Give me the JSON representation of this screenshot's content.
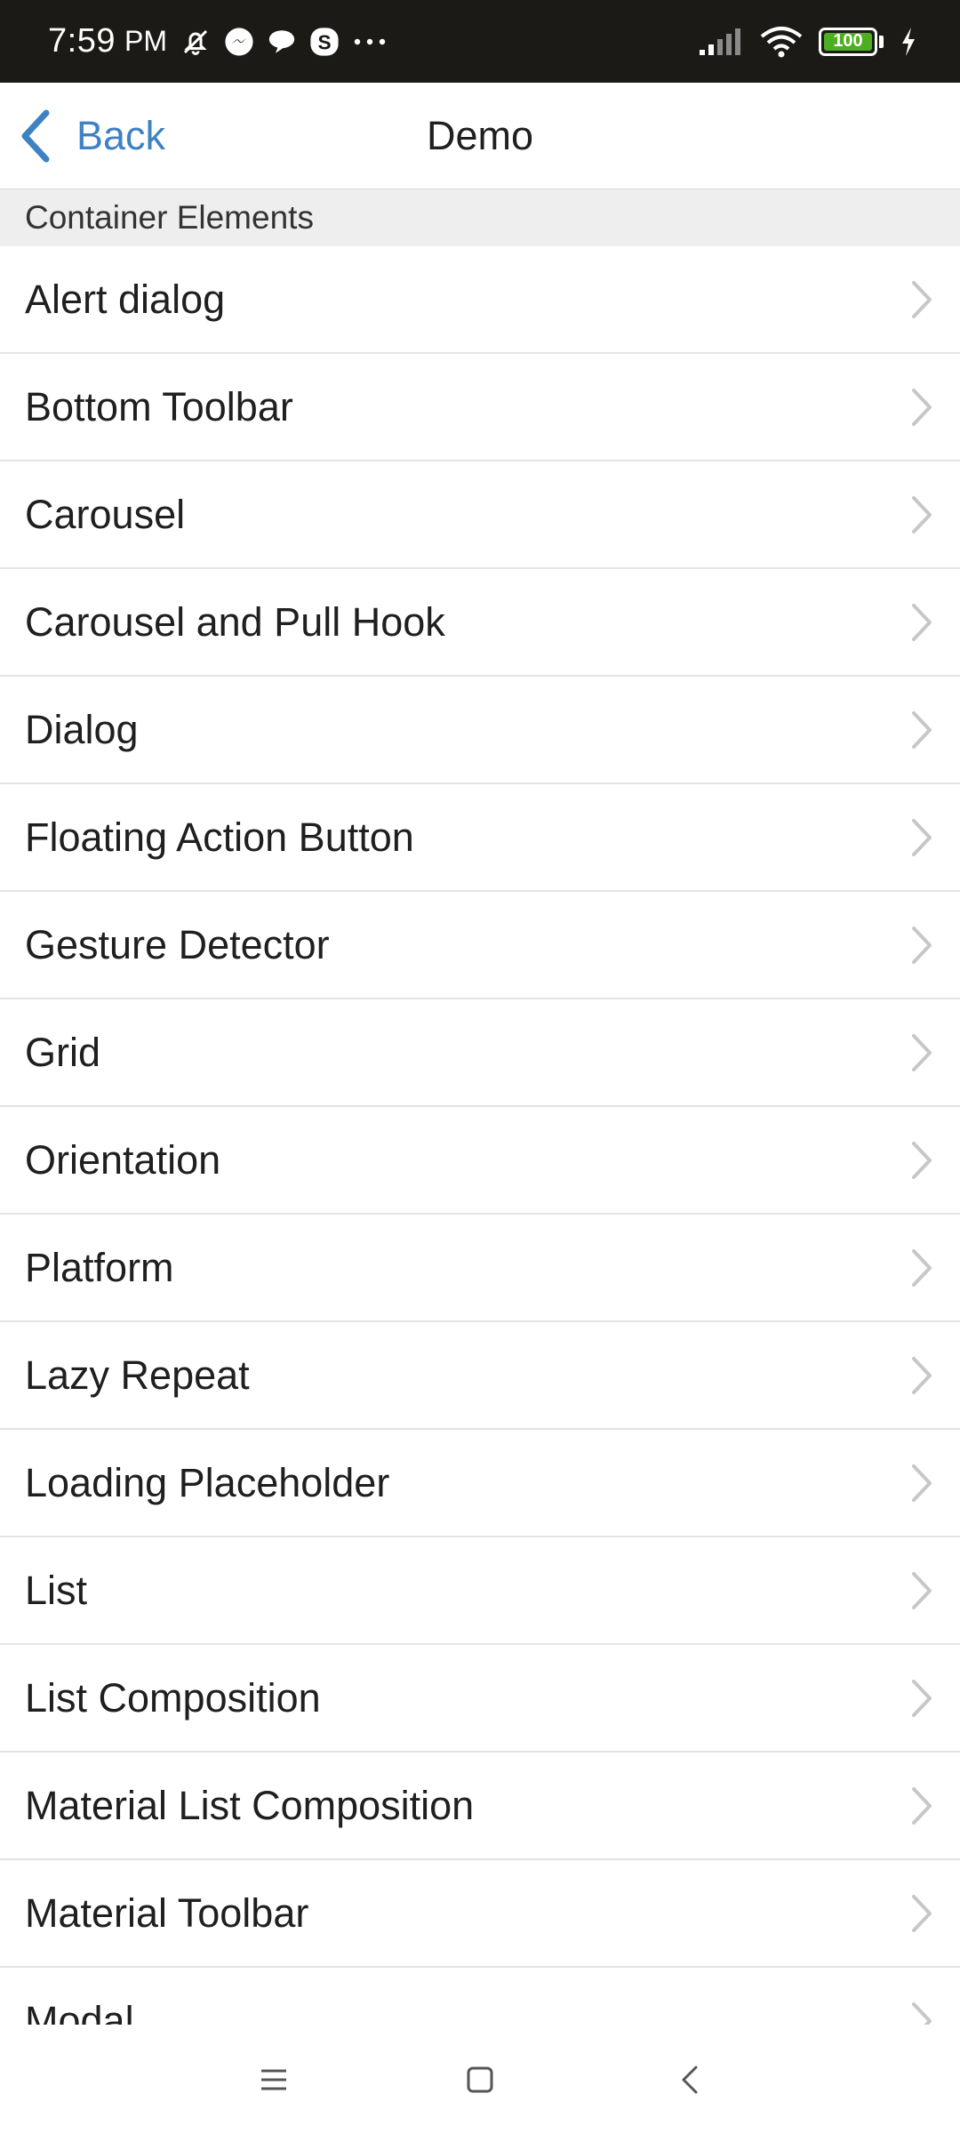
{
  "status_bar": {
    "time": "7:59",
    "ampm": "PM",
    "icons": [
      "bell-off-icon",
      "messenger-icon",
      "chat-bubble-icon",
      "skype-icon",
      "more-dots-icon"
    ],
    "battery_level": "100",
    "colors": {
      "background": "#1c1a17",
      "battery": "#4caf20"
    }
  },
  "nav": {
    "back_label": "Back",
    "title": "Demo",
    "accent_color": "#3f82c4"
  },
  "section": {
    "title": "Container Elements"
  },
  "list": {
    "items": [
      {
        "label": "Alert dialog"
      },
      {
        "label": "Bottom Toolbar"
      },
      {
        "label": "Carousel"
      },
      {
        "label": "Carousel and Pull Hook"
      },
      {
        "label": "Dialog"
      },
      {
        "label": "Floating Action Button"
      },
      {
        "label": "Gesture Detector"
      },
      {
        "label": "Grid"
      },
      {
        "label": "Orientation"
      },
      {
        "label": "Platform"
      },
      {
        "label": "Lazy Repeat"
      },
      {
        "label": "Loading Placeholder"
      },
      {
        "label": "List"
      },
      {
        "label": "List Composition"
      },
      {
        "label": "Material List Composition"
      },
      {
        "label": "Material Toolbar"
      },
      {
        "label": "Modal"
      }
    ]
  },
  "system_nav": {
    "buttons": [
      "menu-icon",
      "home-icon",
      "back-icon"
    ]
  }
}
